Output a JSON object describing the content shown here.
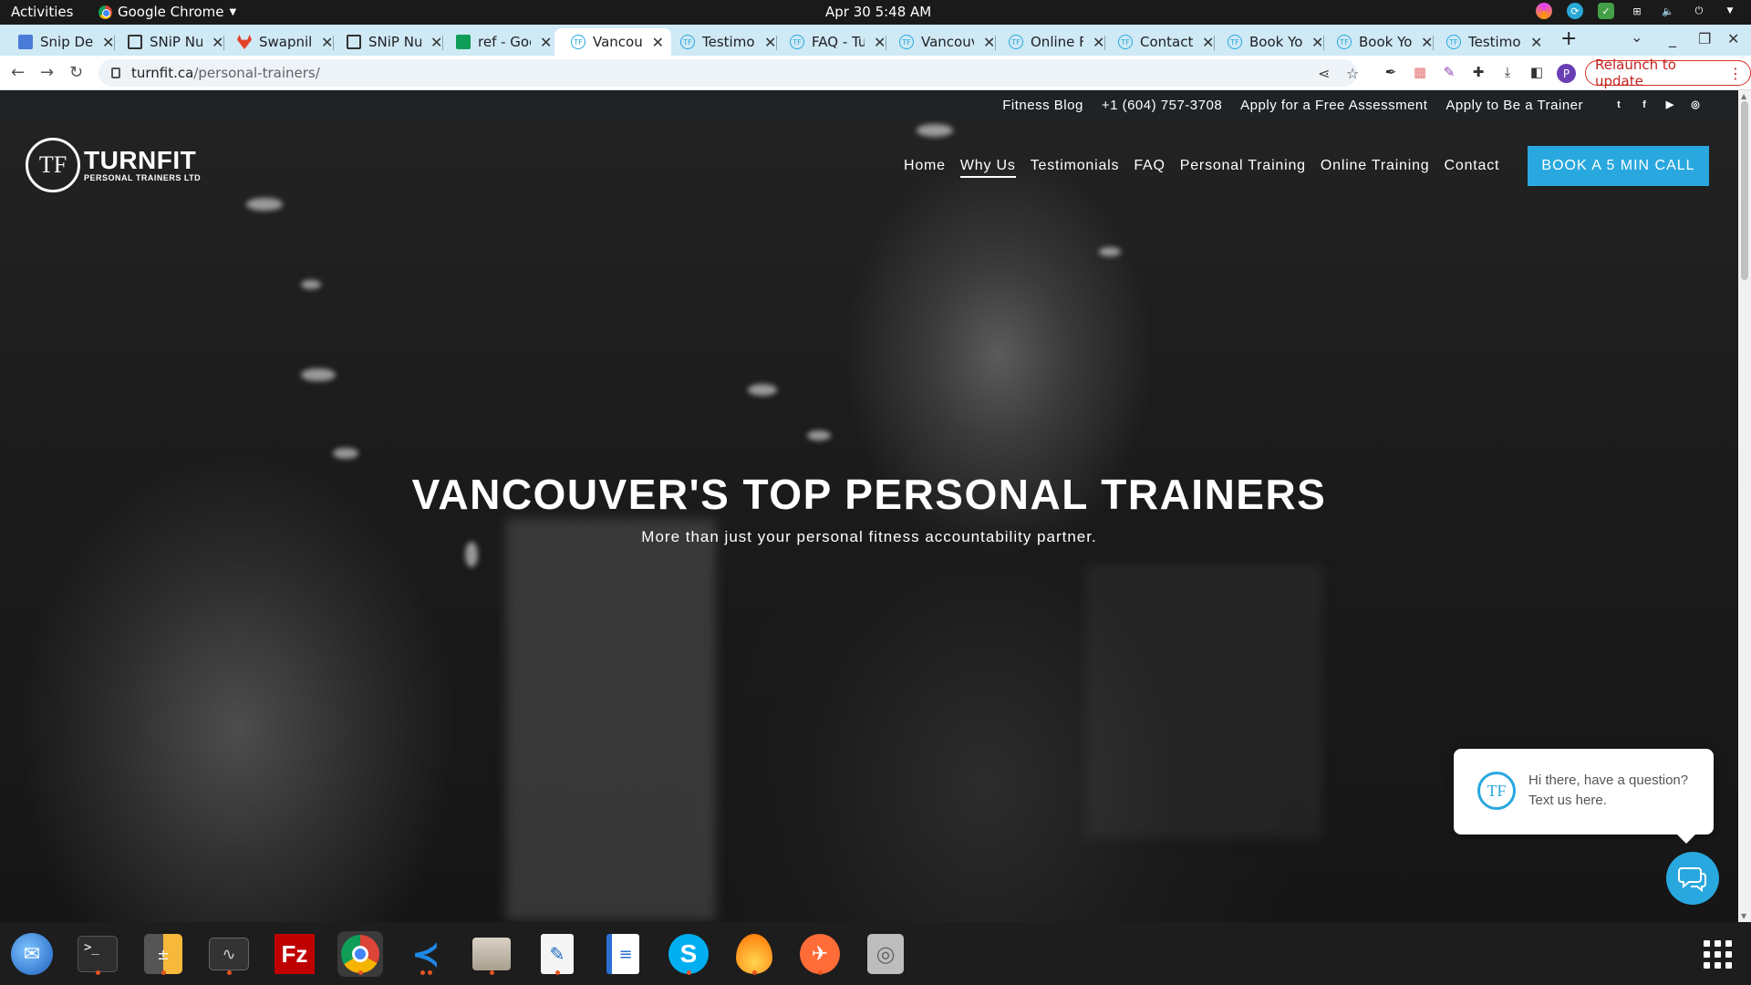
{
  "system": {
    "activities": "Activities",
    "app_name": "Google Chrome",
    "clock": "Apr 30  5:48 AM"
  },
  "tabs": [
    {
      "label": "Snip Det",
      "icon": "doc-icon"
    },
    {
      "label": "SNiP Nu",
      "icon": "snip-icon"
    },
    {
      "label": "Swapnil",
      "icon": "gitlab-icon"
    },
    {
      "label": "SNiP Nu",
      "icon": "snip-icon"
    },
    {
      "label": "ref - Goo",
      "icon": "sheets-icon"
    },
    {
      "label": "Vancouv",
      "icon": "turnfit-icon",
      "active": true
    },
    {
      "label": "Testimo",
      "icon": "turnfit-icon"
    },
    {
      "label": "FAQ - Tu",
      "icon": "turnfit-icon"
    },
    {
      "label": "Vancouv",
      "icon": "turnfit-icon"
    },
    {
      "label": "Online F",
      "icon": "turnfit-icon"
    },
    {
      "label": "Contact",
      "icon": "turnfit-icon"
    },
    {
      "label": "Book Yo",
      "icon": "turnfit-icon"
    },
    {
      "label": "Book Yo",
      "icon": "turnfit-icon"
    },
    {
      "label": "Testimo",
      "icon": "turnfit-icon"
    }
  ],
  "browser": {
    "url_host": "turnfit.ca",
    "url_path": "/personal-trainers/",
    "relaunch_label": "Relaunch to update",
    "profile_initial": "P"
  },
  "site": {
    "utility_links": [
      "Fitness Blog",
      "+1 (604) 757-3708",
      "Apply for a Free Assessment",
      "Apply to Be a Trainer"
    ],
    "logo": {
      "emblem": "TF",
      "name": "TURNFIT",
      "tagline": "PERSONAL TRAINERS LTD"
    },
    "nav": {
      "home": "Home",
      "why_us": "Why Us",
      "testimonials": "Testimonials",
      "faq": "FAQ",
      "personal_training": "Personal Training",
      "online_training": "Online Training",
      "contact": "Contact"
    },
    "cta_label": "BOOK A 5 MIN CALL",
    "hero": {
      "title": "VANCOUVER'S TOP PERSONAL TRAINERS",
      "subtitle": "More than just your personal fitness accountability partner."
    },
    "chat": {
      "emblem": "TF",
      "message": "Hi there, have a question? Text us here."
    }
  },
  "colors": {
    "accent": "#29a8df",
    "tabstrip": "#cfe9f5",
    "relaunch": "#d93025"
  }
}
